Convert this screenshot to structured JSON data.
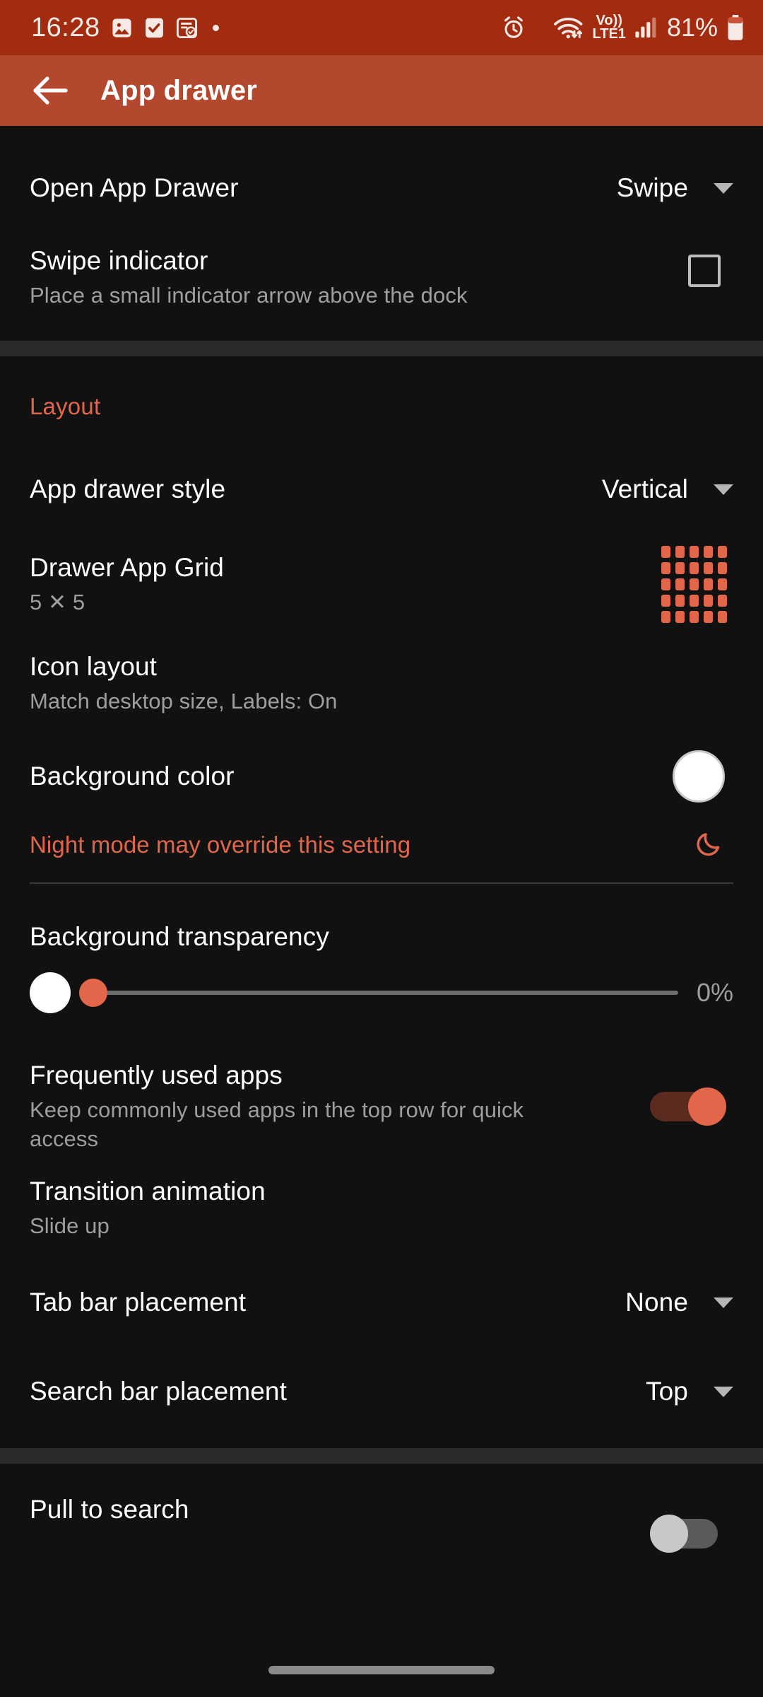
{
  "status_bar": {
    "time": "16:28",
    "left_icons": [
      "image-icon",
      "checkbox-icon",
      "note-task-icon",
      "dot-indicator"
    ],
    "alarm_icon": "alarm-icon",
    "wifi_icon": "wifi-icon",
    "volte_line1": "Vo))",
    "volte_line2": "LTE1",
    "signal_icon": "signal-bars-icon",
    "battery_percent": "81%",
    "battery_icon": "battery-icon",
    "background_color": "#A32B0F"
  },
  "app_bar": {
    "back_icon": "back-arrow-icon",
    "title": "App drawer",
    "background_color": "#B4482E"
  },
  "settings": {
    "open_app_drawer": {
      "title": "Open App Drawer",
      "value": "Swipe"
    },
    "swipe_indicator": {
      "title": "Swipe indicator",
      "subtitle": "Place a small indicator arrow above the dock",
      "checked": "false"
    },
    "layout_section": "Layout",
    "app_drawer_style": {
      "title": "App drawer style",
      "value": "Vertical"
    },
    "drawer_app_grid": {
      "title": "Drawer App Grid",
      "subtitle": "5 ✕ 5",
      "columns": 5,
      "rows": 5
    },
    "icon_layout": {
      "title": "Icon layout",
      "subtitle": "Match desktop size, Labels: On"
    },
    "background_color_row": {
      "title": "Background color",
      "swatch": "#FFFFFF"
    },
    "night_mode_warning": {
      "text": "Night mode may override this setting",
      "icon": "moon-icon"
    },
    "background_transparency": {
      "title": "Background transparency",
      "value": "0%",
      "percent": 0
    },
    "frequently_used_apps": {
      "title": "Frequently used apps",
      "subtitle": "Keep commonly used apps in the top row for quick access",
      "enabled": "true"
    },
    "transition_animation": {
      "title": "Transition animation",
      "subtitle": "Slide up"
    },
    "tab_bar_placement": {
      "title": "Tab bar placement",
      "value": "None"
    },
    "search_bar_placement": {
      "title": "Search bar placement",
      "value": "Top"
    },
    "pull_to_search": {
      "title": "Pull to search",
      "enabled": "false"
    }
  },
  "theme": {
    "accent": "#E2674A",
    "background": "#111111",
    "separator": "#2A2A2A",
    "text_primary": "#FFFFFF",
    "text_secondary": "#9E9E9E"
  }
}
